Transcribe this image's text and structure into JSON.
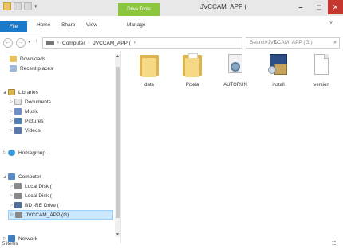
{
  "window": {
    "title": "JVCCAM_APP (",
    "context_tab": "Drive Tools",
    "minimize": "–",
    "maximize": "□",
    "close": "✕"
  },
  "ribbon": {
    "tabs": [
      {
        "label": "File"
      },
      {
        "label": "Home"
      },
      {
        "label": "Share"
      },
      {
        "label": "View"
      },
      {
        "label": "Manage"
      }
    ]
  },
  "address_bar": {
    "breadcrumb": [
      "Computer",
      "JVCCAM_APP (",
      ""
    ],
    "search_placeholder": "Search JVCCAM_APP (G:)"
  },
  "sidebar": {
    "items": [
      {
        "label": "Downloads",
        "icon": "downloads-folder-icon"
      },
      {
        "label": "Recent places",
        "icon": "recent-places-icon"
      },
      {
        "label": "Libraries",
        "icon": "libraries-icon"
      },
      {
        "label": "Documents",
        "icon": "documents-icon"
      },
      {
        "label": "Music",
        "icon": "music-icon"
      },
      {
        "label": "Pictures",
        "icon": "pictures-icon"
      },
      {
        "label": "Videos",
        "icon": "videos-icon"
      },
      {
        "label": "Homegroup",
        "icon": "homegroup-icon"
      },
      {
        "label": "Computer",
        "icon": "computer-icon"
      },
      {
        "label": "Local Disk (",
        "icon": "local-disk-icon"
      },
      {
        "label": "Local Disk (",
        "icon": "local-disk-icon"
      },
      {
        "label": "BD -RE Drive (",
        "icon": "bd-drive-icon"
      },
      {
        "label": "JVCCAM_APP (G)",
        "icon": "camera-drive-icon"
      },
      {
        "label": "Network",
        "icon": "network-icon"
      }
    ]
  },
  "files": [
    {
      "name": "data",
      "icon": "folder-icon"
    },
    {
      "name": "Pixela",
      "icon": "folder-icon"
    },
    {
      "name": "AUTORUN",
      "icon": "autorun-file-icon"
    },
    {
      "name": "install",
      "icon": "installer-icon"
    },
    {
      "name": "version",
      "icon": "text-file-icon"
    }
  ],
  "status": {
    "item_count": "5 items"
  },
  "colors": {
    "file_tab": "#1979ca",
    "drive_tools": "#8cc63f",
    "selection": "#cce8ff",
    "close_button": "#c7372f"
  }
}
